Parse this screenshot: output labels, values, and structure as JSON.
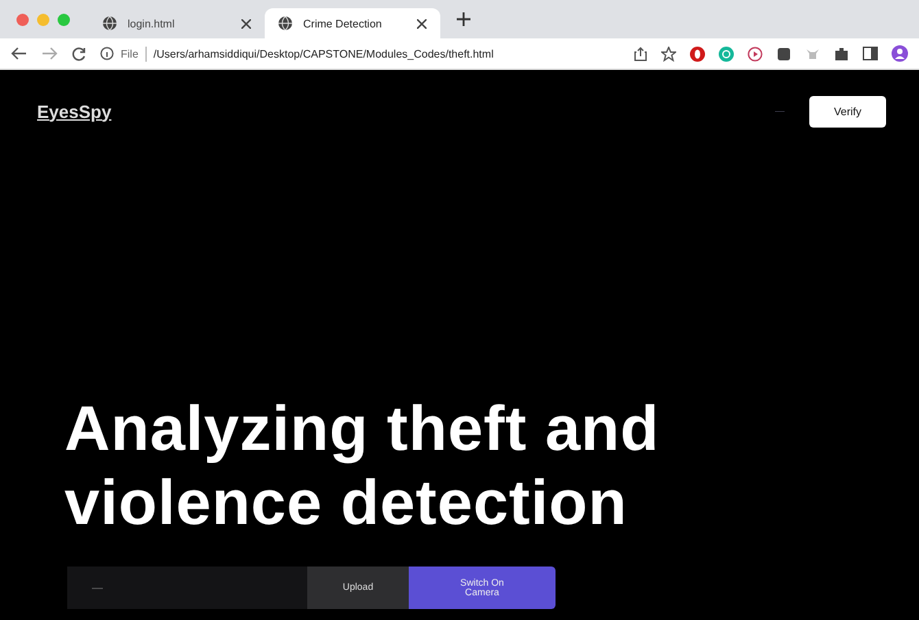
{
  "browser": {
    "tabs": [
      {
        "title": "login.html",
        "selected": false
      },
      {
        "title": "Crime Detection",
        "selected": true
      }
    ],
    "address": {
      "scheme": "File",
      "path": "/Users/arhamsiddiqui/Desktop/CAPSTONE/Modules_Codes/theft.html"
    }
  },
  "page": {
    "logo": "EyesSpy",
    "nav_link": "—",
    "verify_button": "Verify",
    "headline": "Analyzing theft and violence detection",
    "field": {
      "placeholder": "—"
    },
    "upload_button": "Upload",
    "camera_button": "Switch On Camera"
  }
}
